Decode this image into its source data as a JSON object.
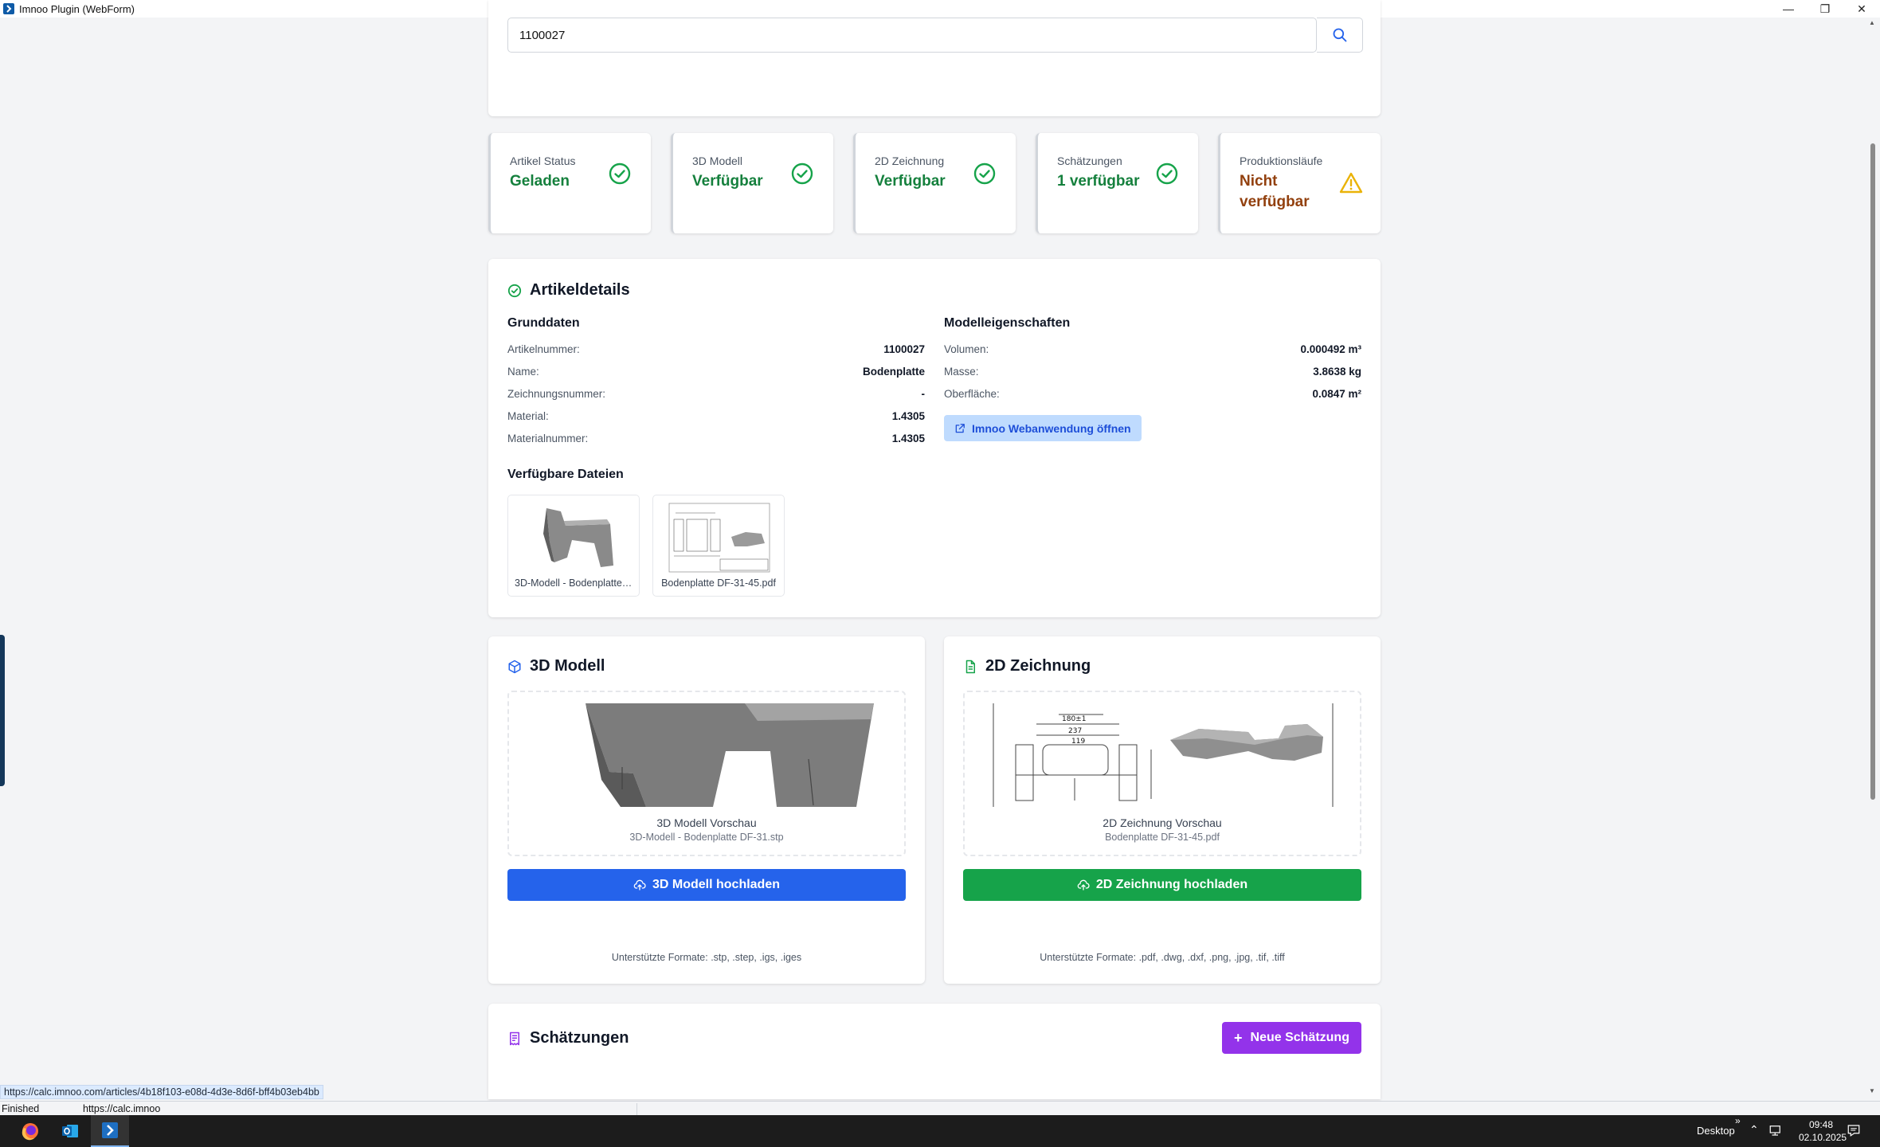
{
  "window": {
    "title": "Imnoo Plugin (WebForm)"
  },
  "search": {
    "value": "1100027"
  },
  "status_cards": [
    {
      "label": "Artikel Status",
      "value": "Geladen",
      "state": "ok",
      "color": "#15803d"
    },
    {
      "label": "3D Modell",
      "value": "Verfügbar",
      "state": "ok",
      "color": "#15803d"
    },
    {
      "label": "2D Zeichnung",
      "value": "Verfügbar",
      "state": "ok",
      "color": "#15803d"
    },
    {
      "label": "Schätzungen",
      "value": "1 verfügbar",
      "state": "ok",
      "color": "#15803d"
    },
    {
      "label": "Produktionsläufe",
      "value": "Nicht verfügbar",
      "state": "warning",
      "color": "#92400e"
    }
  ],
  "details": {
    "title": "Artikeldetails",
    "grunddaten": {
      "heading": "Grunddaten",
      "rows": [
        {
          "key": "Artikelnummer:",
          "value": "1100027"
        },
        {
          "key": "Name:",
          "value": "Bodenplatte"
        },
        {
          "key": "Zeichnungsnummer:",
          "value": "-"
        },
        {
          "key": "Material:",
          "value": "1.4305"
        },
        {
          "key": "Materialnummer:",
          "value": "1.4305"
        }
      ]
    },
    "modell": {
      "heading": "Modelleigenschaften",
      "rows": [
        {
          "key": "Volumen:",
          "value": "0.000492 m³"
        },
        {
          "key": "Masse:",
          "value": "3.8638 kg"
        },
        {
          "key": "Oberfläche:",
          "value": "0.0847 m²"
        }
      ],
      "webapp_label": "Imnoo Webanwendung öffnen"
    },
    "files": {
      "heading": "Verfügbare Dateien",
      "items": [
        {
          "name": "3D-Modell - Bodenplatte DF-31.stp",
          "icon": "3d-model-thumbnail"
        },
        {
          "name": "Bodenplatte DF-31-45.pdf",
          "icon": "drawing-thumbnail"
        }
      ]
    }
  },
  "model3d": {
    "title": "3D Modell",
    "preview_title": "3D Modell Vorschau",
    "preview_file": "3D-Modell - Bodenplatte DF-31.stp",
    "upload_label": "3D Modell hochladen",
    "formats": "Unterstützte Formate: .stp, .step, .igs, .iges",
    "accent": "#2563eb"
  },
  "drawing2d": {
    "title": "2D Zeichnung",
    "preview_title": "2D Zeichnung Vorschau",
    "preview_file": "Bodenplatte DF-31-45.pdf",
    "upload_label": "2D Zeichnung hochladen",
    "formats": "Unterstützte Formate: .pdf, .dwg, .dxf, .png, .jpg, .tif, .tiff",
    "accent": "#16a34a"
  },
  "estimates": {
    "title": "Schätzungen",
    "new_label": "Neue Schätzung",
    "accent": "#9333ea"
  },
  "browser": {
    "hover_url": "https://calc.imnoo.com/articles/4b18f103-e08d-4d3e-8d6f-bff4b03eb4bb",
    "status": "Finished",
    "location": "https://calc.imnoo"
  },
  "taskbar": {
    "desktop_label": "Desktop",
    "time": "09:48",
    "date": "02.10.2025"
  }
}
